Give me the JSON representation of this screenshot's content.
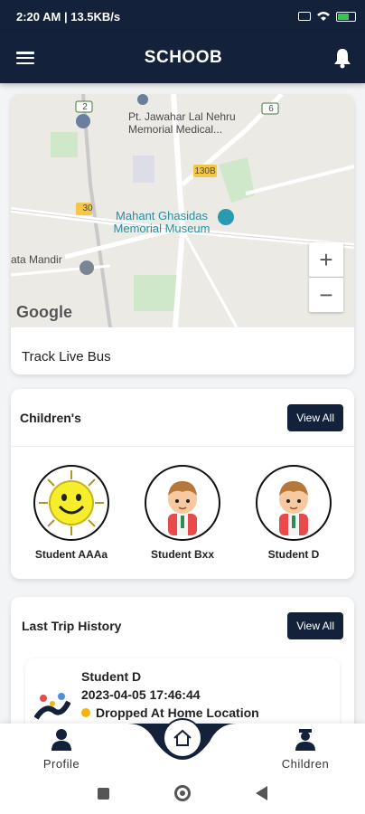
{
  "status_bar": {
    "text": "2:20 AM | 13.5KB/s",
    "battery": "84"
  },
  "app": {
    "title": "SCHOOB"
  },
  "map": {
    "labels": {
      "hospital": "Pt. Jawahar Lal Nehru\nMemorial Medical...",
      "museum": "Mahant Ghasidas\nMemorial Museum",
      "temple": "ata Mandir",
      "road_2": "2",
      "road_6": "6",
      "road_30": "30",
      "road_130b": "130B"
    },
    "attribution": "Google",
    "zoom_in": "+",
    "zoom_out": "−"
  },
  "track": {
    "label": "Track Live Bus"
  },
  "children": {
    "title": "Children's",
    "view_all": "View All",
    "items": [
      {
        "name": "Student AAAa",
        "avatar": "sun-avatar"
      },
      {
        "name": "Student Bxx",
        "avatar": "boy-avatar"
      },
      {
        "name": "Student D",
        "avatar": "boy-avatar"
      }
    ]
  },
  "trip_history": {
    "title": "Last Trip History",
    "view_all": "View All",
    "entry": {
      "name": "Student D",
      "datetime": "2023-04-05 17:46:44",
      "status": "Dropped At Home Location",
      "status_color": "#f5b40a"
    }
  },
  "bottom_nav": {
    "profile": "Profile",
    "children": "Children"
  },
  "colors": {
    "primary": "#14213a",
    "accent": "#f5b40a"
  }
}
